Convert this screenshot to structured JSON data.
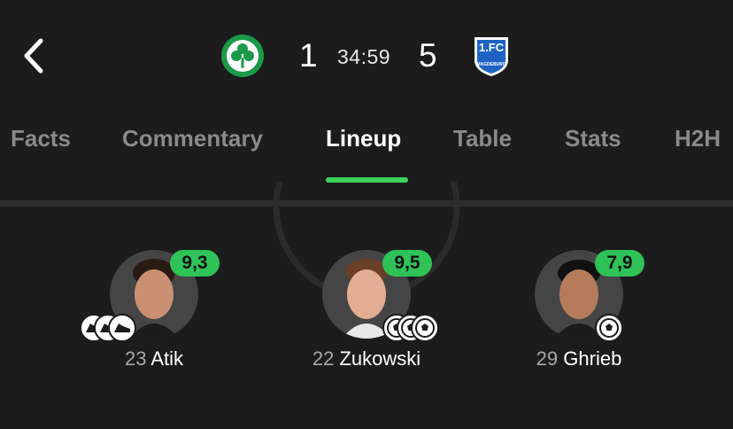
{
  "header": {
    "back_icon": "chevron-left-icon",
    "home_crest_icon": "shamrock-crest-icon",
    "away_crest_icon": "magdeburg-crest-icon",
    "away_crest_text_top": "1.FC",
    "away_crest_text_side": "MAGDEBURG",
    "home_score": "1",
    "clock": "34:59",
    "away_score": "5"
  },
  "tabs": [
    {
      "label": "Facts",
      "active": false
    },
    {
      "label": "Commentary",
      "active": false
    },
    {
      "label": "Lineup",
      "active": true
    },
    {
      "label": "Table",
      "active": false
    },
    {
      "label": "Stats",
      "active": false
    },
    {
      "label": "H2H",
      "active": false
    }
  ],
  "colors": {
    "background": "#1c1c1c",
    "accent": "#3bd35c",
    "rating_bg": "#2fc257",
    "home_crest": "#1b9a4a",
    "away_crest": "#1e63c4"
  },
  "players": [
    {
      "number": "23",
      "name": "Atik",
      "rating": "9,3",
      "events": [
        "assist-boot-icon",
        "assist-boot-icon",
        "assist-boot-icon"
      ]
    },
    {
      "number": "22",
      "name": "Zukowski",
      "rating": "9,5",
      "events": [
        "goal-ball-icon",
        "goal-ball-icon",
        "goal-ball-icon"
      ]
    },
    {
      "number": "29",
      "name": "Ghrieb",
      "rating": "7,9",
      "events": [
        "goal-ball-icon"
      ]
    }
  ]
}
